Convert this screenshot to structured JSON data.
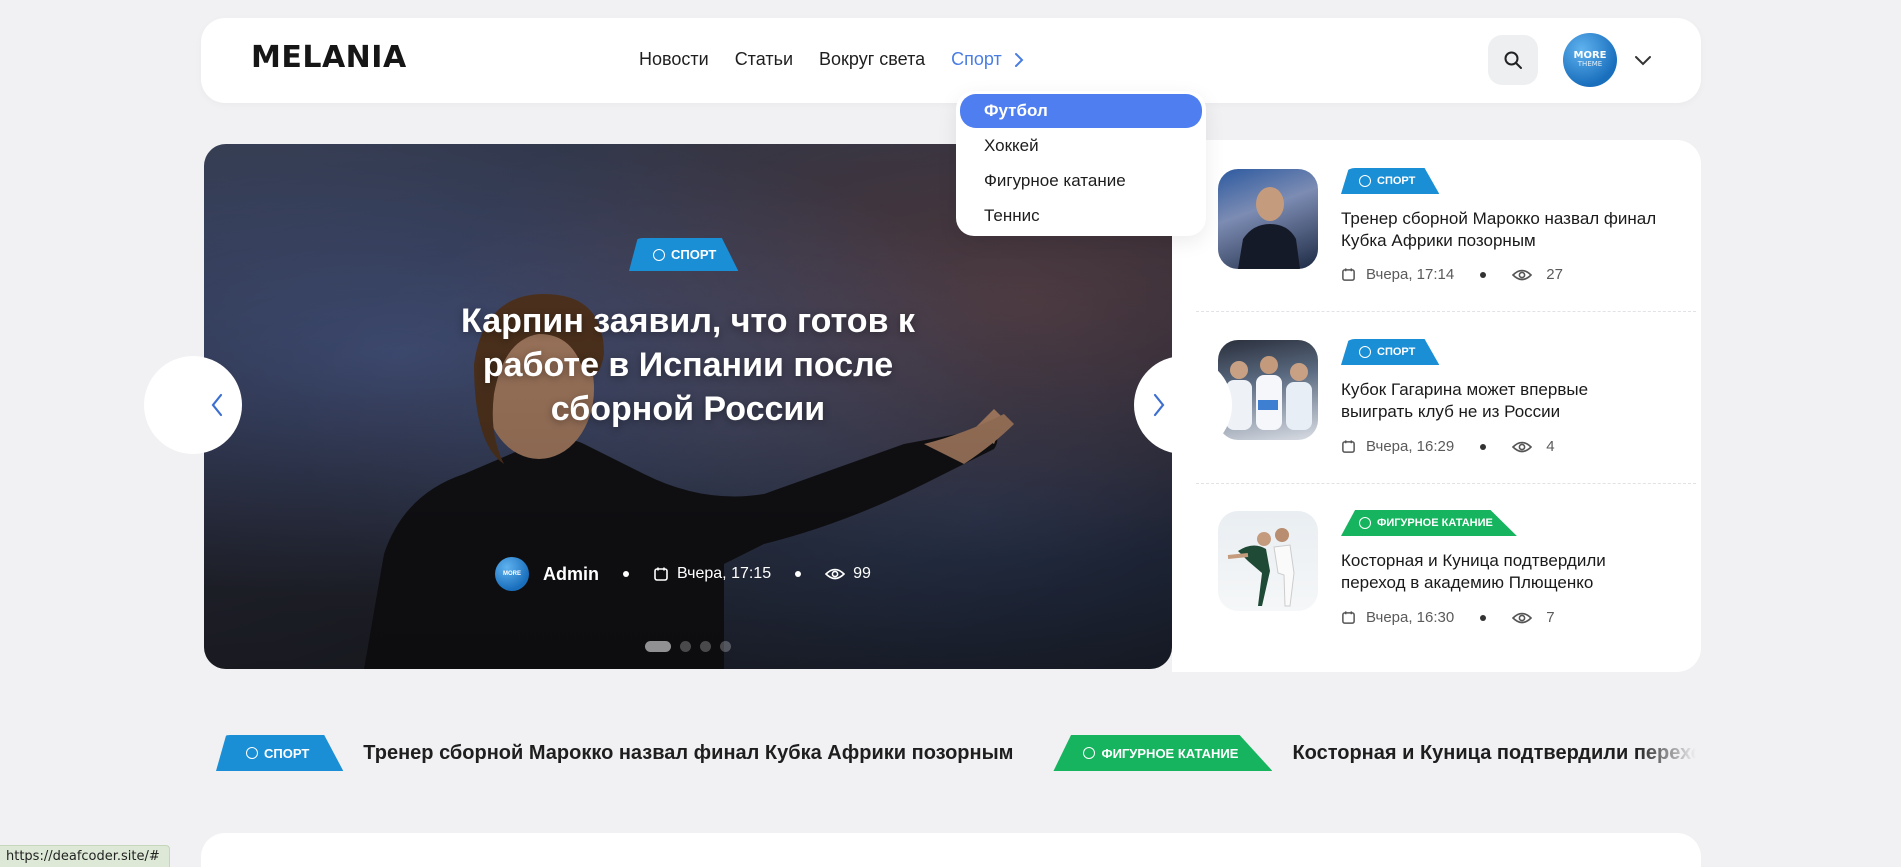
{
  "header": {
    "logo": "MELANIA",
    "nav": [
      {
        "label": "Новости"
      },
      {
        "label": "Статьи"
      },
      {
        "label": "Вокруг света"
      },
      {
        "label": "Спорт"
      }
    ],
    "avatar_text_top": "MORE",
    "avatar_text_bottom": "THEME"
  },
  "dropdown": {
    "items": [
      "Футбол",
      "Хоккей",
      "Фигурное катание",
      "Теннис"
    ],
    "selected": "Футбол"
  },
  "hero": {
    "badge": "спорт",
    "title": "Карпин заявил, что готов к работе в Испании после сборной России",
    "author": "Admin",
    "avatar_text": "MORE",
    "date": "Вчера, 17:15",
    "views": "99",
    "slides": 4,
    "active_slide": 1
  },
  "side_list": [
    {
      "badge": "спорт",
      "title": "Тренер сборной Марокко назвал финал Кубка Африки позорным",
      "date": "Вчера, 17:14",
      "views": "27"
    },
    {
      "badge": "спорт",
      "title": "Кубок Гагарина может впервые выиграть клуб не из России",
      "date": "Вчера, 16:29",
      "views": "4"
    },
    {
      "badge": "фигурное катание",
      "title": "Косторная и Куница подтвердили переход в академию Плющенко",
      "date": "Вчера, 16:30",
      "views": "7"
    }
  ],
  "ticker": [
    {
      "badge": "спорт",
      "text": "Тренер сборной Марокко назвал финал Кубка Африки позорным"
    },
    {
      "badge": "фигурное катание",
      "text": "Косторная и Куница подтвердили переход в академию Плющенко"
    }
  ],
  "status_bar": {
    "url": "https://deafcoder.site/#"
  },
  "colors": {
    "accent": "#4f7ef0",
    "badge_blue": "#1a8fd6",
    "badge_green": "#16b45f",
    "background": "#f1f1f3"
  }
}
